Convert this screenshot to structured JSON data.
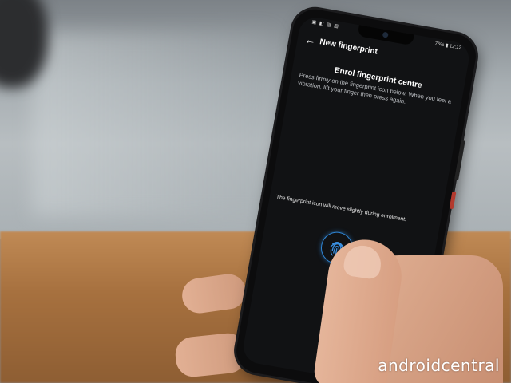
{
  "status_bar": {
    "left_icons": "▣ ◧ ▤ ▥",
    "battery": "75%",
    "time": "12:12"
  },
  "app_bar": {
    "back_icon": "arrow-left-icon",
    "title": "New fingerprint"
  },
  "enrol": {
    "title": "Enrol fingerprint centre",
    "description": "Press firmly on the fingerprint icon below. When you feel a vibration, lift your finger then press again.",
    "hint": "The fingerprint icon will move slightly during enrolment."
  },
  "fingerprint": {
    "icon": "fingerprint-icon",
    "accent_color": "#2f86d6"
  },
  "watermark": {
    "text": "androidcentral"
  }
}
